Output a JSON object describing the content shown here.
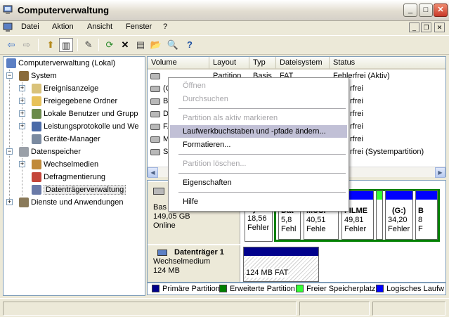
{
  "window": {
    "title": "Computerverwaltung"
  },
  "caption_buttons": {
    "minimize": "_",
    "maximize": "□",
    "close": "✕"
  },
  "mdi_buttons": {
    "minimize": "_",
    "restore": "❐",
    "close": "✕"
  },
  "menubar": [
    "Datei",
    "Aktion",
    "Ansicht",
    "Fenster",
    "?"
  ],
  "toolbar": [
    {
      "name": "back-icon",
      "glyph": "⇦"
    },
    {
      "name": "forward-icon",
      "glyph": "⇨"
    },
    {
      "name": "up-folder-icon",
      "glyph": "⬆"
    },
    {
      "name": "show-hide-tree-icon",
      "glyph": "▥"
    },
    {
      "name": "properties-icon",
      "glyph": "✎"
    },
    {
      "name": "refresh-icon",
      "glyph": "⟳"
    },
    {
      "name": "delete-icon",
      "glyph": "✕"
    },
    {
      "name": "properties-sheet-icon",
      "glyph": "▤"
    },
    {
      "name": "open-folder-icon",
      "glyph": "📂"
    },
    {
      "name": "search-icon",
      "glyph": "🔍"
    },
    {
      "name": "help-icon",
      "glyph": "?"
    }
  ],
  "tree": {
    "root": "Computerverwaltung (Lokal)",
    "system": "System",
    "ereignisanzeige": "Ereignisanzeige",
    "freigegebene": "Freigegebene Ordner",
    "benutzer": "Lokale Benutzer und Grupp",
    "leistung": "Leistungsprotokolle und We",
    "geraete": "Geräte-Manager",
    "datenspeicher": "Datenspeicher",
    "wechselmedien": "Wechselmedien",
    "defrag": "Defragmentierung",
    "dtv": "Datenträgerverwaltung",
    "dienste": "Dienste und Anwendungen"
  },
  "columns": [
    "Volume",
    "Layout",
    "Typ",
    "Dateisystem",
    "Status"
  ],
  "volumes": [
    {
      "volume": "",
      "layout": "Partition",
      "typ": "Basis",
      "fs": "FAT",
      "status": "Fehlerfrei (Aktiv)"
    },
    {
      "volume": "(C",
      "layout": "",
      "typ": "",
      "fs": "",
      "status": "rfrei"
    },
    {
      "volume": "Bo",
      "layout": "",
      "typ": "",
      "fs": "",
      "status": "rfrei"
    },
    {
      "volume": "D",
      "layout": "",
      "typ": "",
      "fs": "",
      "status": "rfrei"
    },
    {
      "volume": "FA",
      "layout": "",
      "typ": "",
      "fs": "",
      "status": "rfrei"
    },
    {
      "volume": "M",
      "layout": "",
      "typ": "",
      "fs": "",
      "status": "rfrei"
    },
    {
      "volume": "Sy",
      "layout": "",
      "typ": "",
      "fs": "",
      "status": "rfrei (Systempartition)"
    }
  ],
  "disk0": {
    "label": "Bas",
    "size": "149,05 GB",
    "status": "Online",
    "partitions": [
      {
        "name": "Syste",
        "size": "18,56",
        "status": "Fehler"
      },
      {
        "name": "Dat",
        "size": "5,8",
        "status": "Fehl"
      },
      {
        "name": "MUSI",
        "size": "40,51",
        "status": "Fehle"
      },
      {
        "name": "FILME",
        "size": "49,81",
        "status": "Fehler"
      },
      {
        "name": "",
        "size": "",
        "status": ""
      },
      {
        "name": "(G:)",
        "size": "34,20",
        "status": "Fehler"
      },
      {
        "name": "B",
        "size": "8",
        "status": "F"
      }
    ]
  },
  "disk1": {
    "name": "Datenträger 1",
    "type": "Wechselmedium",
    "size": "124 MB",
    "partition": "124 MB FAT"
  },
  "legend": [
    {
      "label": "Primäre Partition",
      "color": "#00008b"
    },
    {
      "label": "Erweiterte Partition",
      "color": "#008000"
    },
    {
      "label": "Freier Speicherplatz",
      "color": "#33ff33"
    },
    {
      "label": "Logisches Laufw",
      "color": "#0000ff"
    }
  ],
  "context_menu": {
    "open": "Öffnen",
    "explore": "Durchsuchen",
    "mark_active": "Partition als aktiv markieren",
    "change_letter": "Laufwerkbuchstaben und -pfade ändern...",
    "format": "Formatieren...",
    "delete": "Partition löschen...",
    "properties": "Eigenschaften",
    "help": "Hilfe"
  }
}
